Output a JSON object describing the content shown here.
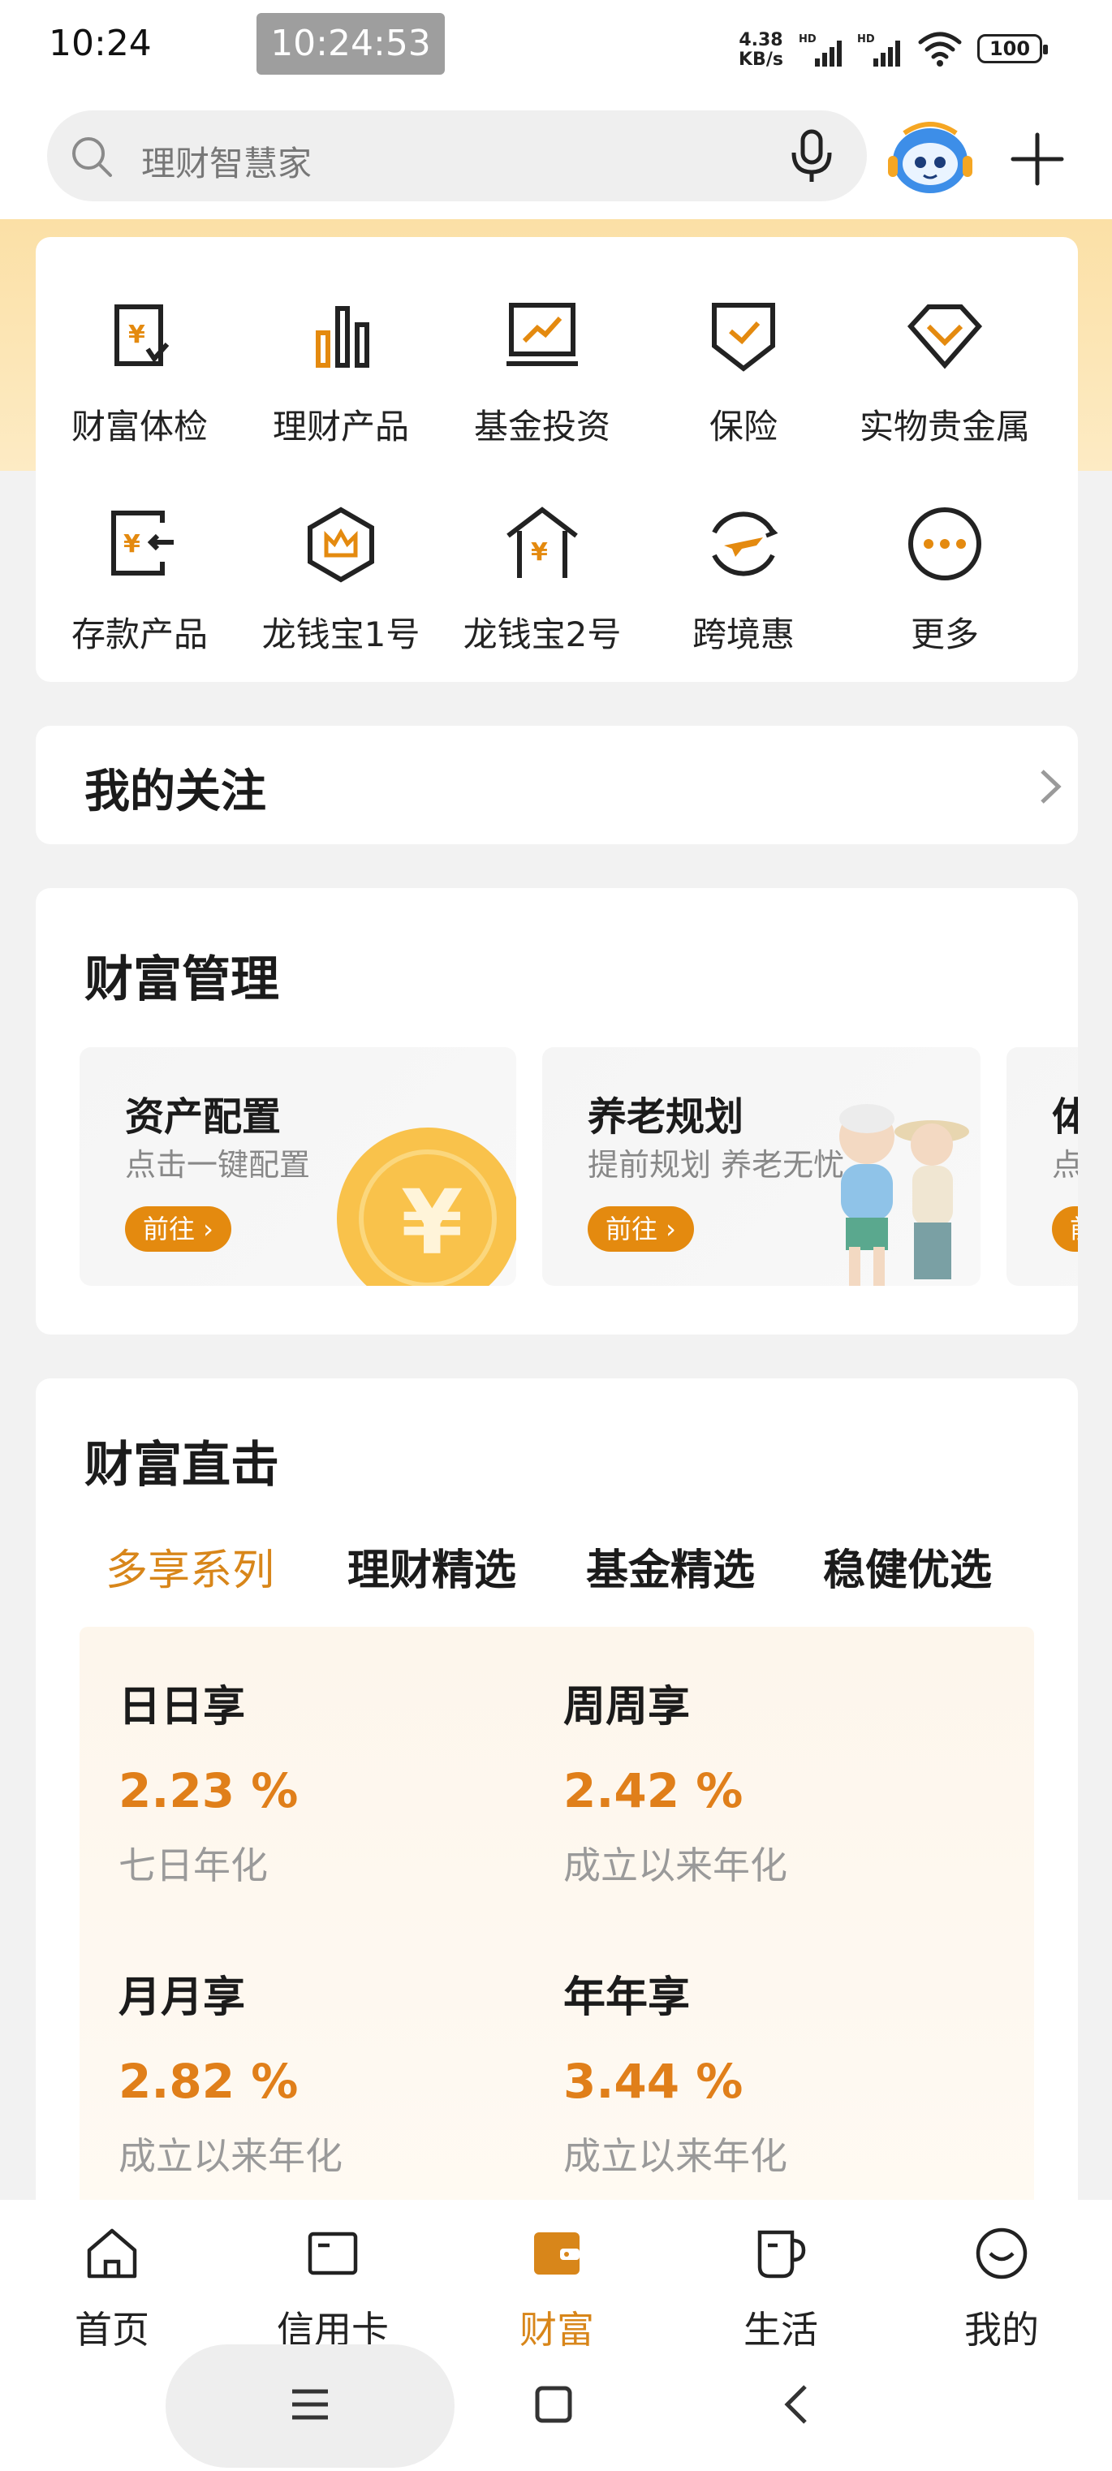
{
  "status_bar": {
    "time": "10:24",
    "recording_time": "10:24:53",
    "net_speed_value": "4.38",
    "net_speed_unit": "KB/s",
    "sim1_label": "HD",
    "sim2_label": "HD",
    "battery": "100"
  },
  "search": {
    "placeholder": "理财智慧家"
  },
  "services": [
    {
      "label": "财富体检",
      "icon": "wealth-checkup-icon"
    },
    {
      "label": "理财产品",
      "icon": "bar-chart-icon"
    },
    {
      "label": "基金投资",
      "icon": "fund-chart-icon"
    },
    {
      "label": "保险",
      "icon": "insurance-shield-icon"
    },
    {
      "label": "实物贵金属",
      "icon": "diamond-icon"
    },
    {
      "label": "存款产品",
      "icon": "deposit-icon"
    },
    {
      "label": "龙钱宝1号",
      "icon": "crown-hexagon-icon"
    },
    {
      "label": "龙钱宝2号",
      "icon": "yuan-house-icon"
    },
    {
      "label": "跨境惠",
      "icon": "plane-icon"
    },
    {
      "label": "更多",
      "icon": "more-dots-icon"
    }
  ],
  "my_follow": {
    "title": "我的关注"
  },
  "wealth_management": {
    "title": "财富管理",
    "tiles": [
      {
        "title": "资产配置",
        "subtitle": "点击一键配置",
        "button": "前往 ›"
      },
      {
        "title": "养老规划",
        "subtitle": "提前规划 养老无忧",
        "button": "前往 ›"
      },
      {
        "title": "体",
        "subtitle": "点",
        "button": "前"
      }
    ]
  },
  "wealth_direct": {
    "title": "财富直击",
    "tabs": [
      "多享系列",
      "理财精选",
      "基金精选",
      "稳健优选"
    ],
    "active_tab": 0,
    "products": [
      {
        "name": "日日享",
        "rate": "2.23 %",
        "desc": "七日年化"
      },
      {
        "name": "周周享",
        "rate": "2.42 %",
        "desc": "成立以来年化"
      },
      {
        "name": "月月享",
        "rate": "2.82 %",
        "desc": "成立以来年化"
      },
      {
        "name": "年年享",
        "rate": "3.44 %",
        "desc": "成立以来年化"
      }
    ]
  },
  "bottom_nav": {
    "items": [
      {
        "label": "首页",
        "icon": "home-icon"
      },
      {
        "label": "信用卡",
        "icon": "credit-card-icon"
      },
      {
        "label": "财富",
        "icon": "wallet-icon"
      },
      {
        "label": "生活",
        "icon": "cup-icon"
      },
      {
        "label": "我的",
        "icon": "smiley-icon"
      }
    ],
    "active_index": 2
  },
  "colors": {
    "accent": "#e48a0f",
    "rate": "#e07f1a",
    "gold_band": "#fbe0a6"
  }
}
